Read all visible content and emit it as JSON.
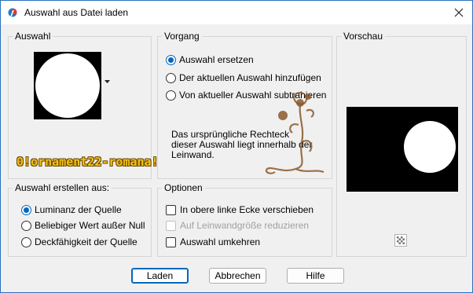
{
  "window": {
    "title": "Auswahl aus Datei laden"
  },
  "groups": {
    "auswahl": {
      "label": "Auswahl"
    },
    "vorgang": {
      "label": "Vorgang",
      "options": [
        {
          "label": "Auswahl ersetzen",
          "checked": true
        },
        {
          "label": "Der aktuellen Auswahl hinzufügen",
          "checked": false
        },
        {
          "label": "Von aktueller Auswahl subtrahieren",
          "checked": false
        }
      ],
      "info": "Das ursprüngliche Rechteck dieser Auswahl liegt innerhalb der Leinwand."
    },
    "vorschau": {
      "label": "Vorschau"
    },
    "erstellen": {
      "label": "Auswahl erstellen aus:",
      "options": [
        {
          "label": "Luminanz der Quelle",
          "checked": true
        },
        {
          "label": "Beliebiger Wert außer Null",
          "checked": false
        },
        {
          "label": "Deckfähigkeit der Quelle",
          "checked": false
        }
      ]
    },
    "optionen": {
      "label": "Optionen",
      "checks": [
        {
          "label": "In obere linke Ecke verschieben",
          "checked": false,
          "enabled": true
        },
        {
          "label": "Auf Leinwandgröße reduzieren",
          "checked": false,
          "enabled": false
        },
        {
          "label": "Auswahl umkehren",
          "checked": false,
          "enabled": true
        }
      ]
    }
  },
  "watermark": "0!ornament22-romana!",
  "buttons": {
    "load": "Laden",
    "cancel": "Abbrechen",
    "help": "Hilfe"
  },
  "colors": {
    "accent": "#0067c0",
    "watermark": "#f4c21b"
  }
}
